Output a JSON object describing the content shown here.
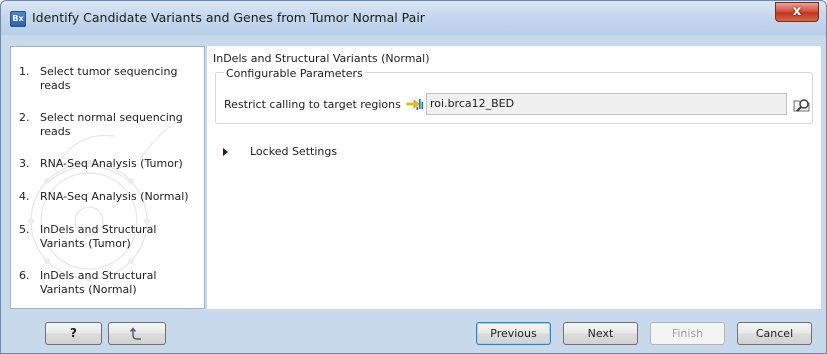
{
  "window": {
    "title": "Identify Candidate Variants and Genes from Tumor Normal Pair",
    "app_icon_text": "Bx",
    "close_glyph": "x"
  },
  "steps": [
    {
      "num": "1.",
      "label": "Select tumor sequencing reads"
    },
    {
      "num": "2.",
      "label": "Select normal sequencing reads"
    },
    {
      "num": "3.",
      "label": "RNA-Seq Analysis (Tumor)"
    },
    {
      "num": "4.",
      "label": "RNA-Seq Analysis (Normal)"
    },
    {
      "num": "5.",
      "label": "InDels and Structural Variants (Tumor)"
    },
    {
      "num": "6.",
      "label": "InDels and Structural Variants (Normal)"
    }
  ],
  "main": {
    "section_title": "InDels and Structural Variants (Normal)",
    "group_title": "Configurable Parameters",
    "restrict_label": "Restrict calling to target regions",
    "restrict_value": "roi.brca12_BED",
    "locked_label": "Locked Settings"
  },
  "buttons": {
    "help": "?",
    "previous": "Previous",
    "next": "Next",
    "finish": "Finish",
    "cancel": "Cancel"
  },
  "icons": {
    "target_regions": "target-regions-icon",
    "browse": "browse-icon",
    "reset": "reset-icon",
    "watermark": "clc-bio-watermark"
  }
}
